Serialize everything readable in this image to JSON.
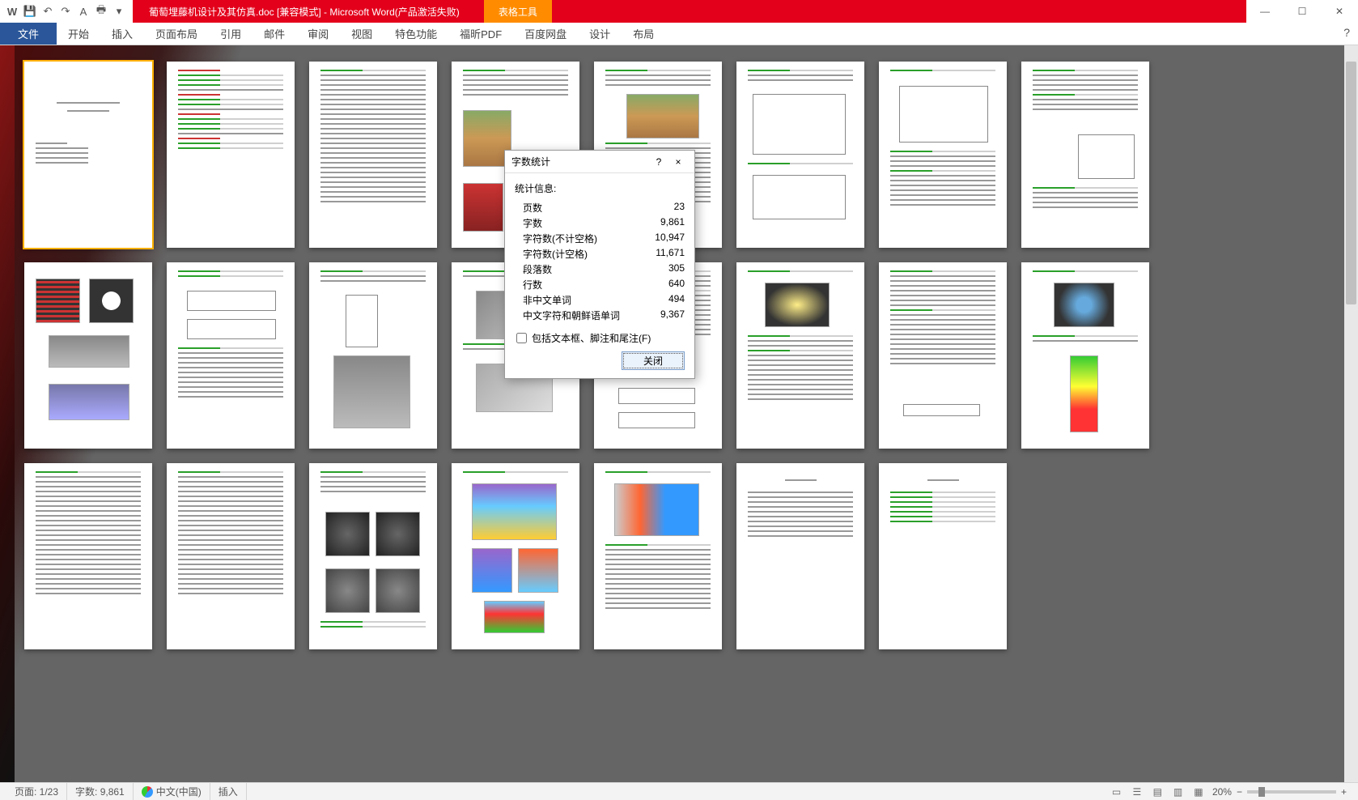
{
  "titlebar": {
    "doc_title": "葡萄埋藤机设计及其仿真.doc [兼容模式] - Microsoft Word(产品激活失败)",
    "table_tools": "表格工具"
  },
  "quick_access": {
    "app": "W",
    "save": "💾",
    "undo": "↶",
    "redo": "↷",
    "style": "A",
    "print": "🖶",
    "expand": "▾"
  },
  "win_controls": {
    "min": "—",
    "max": "☐",
    "close": "✕"
  },
  "ribbon": {
    "tabs": [
      "文件",
      "开始",
      "插入",
      "页面布局",
      "引用",
      "邮件",
      "审阅",
      "视图",
      "特色功能",
      "福昕PDF",
      "百度网盘"
    ],
    "context_tabs": [
      "设计",
      "布局"
    ],
    "help": "?"
  },
  "dialog": {
    "title": "字数统计",
    "help": "?",
    "close": "×",
    "info_label": "统计信息:",
    "rows": [
      {
        "k": "页数",
        "v": "23"
      },
      {
        "k": "字数",
        "v": "9,861"
      },
      {
        "k": "字符数(不计空格)",
        "v": "10,947"
      },
      {
        "k": "字符数(计空格)",
        "v": "11,671"
      },
      {
        "k": "段落数",
        "v": "305"
      },
      {
        "k": "行数",
        "v": "640"
      },
      {
        "k": "非中文单词",
        "v": "494"
      },
      {
        "k": "中文字符和朝鲜语单词",
        "v": "9,367"
      }
    ],
    "checkbox_label": "包括文本框、脚注和尾注(F)",
    "close_button": "关闭"
  },
  "statusbar": {
    "page": "页面: 1/23",
    "words": "字数: 9,861",
    "language": "中文(中国)",
    "mode": "插入",
    "zoom_value": "20%",
    "zoom_minus": "−",
    "zoom_plus": "+"
  },
  "view_icons": [
    "▭",
    "☰",
    "▤",
    "▥",
    "▦"
  ]
}
